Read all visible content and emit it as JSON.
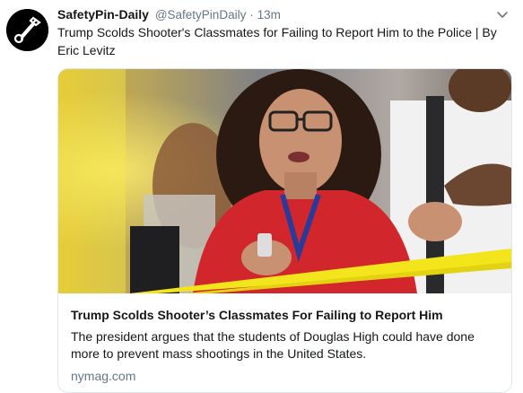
{
  "tweet": {
    "author": {
      "display_name": "SafetyPin-Daily",
      "handle": "@SafetyPinDaily",
      "separator": "·",
      "time": "13m",
      "avatar_icon": "safety-pin-logo-icon"
    },
    "menu_icon": "chevron-down-icon",
    "text": "Trump Scolds Shooter's Classmates for Failing to Report Him to the Police  | By Eric Levitz",
    "card": {
      "title": "Trump Scolds Shooter’s Classmates For Failing to Report Him",
      "description": "The president argues that the students of Douglas High could have done more to prevent mass shootings in the United States.",
      "domain": "nymag.com"
    }
  },
  "colors": {
    "name_text": "#14171a",
    "secondary_text": "#657786",
    "card_border": "#e1e8ed",
    "police_tape": "#f2e51c",
    "shirt_red": "#d1262b"
  }
}
